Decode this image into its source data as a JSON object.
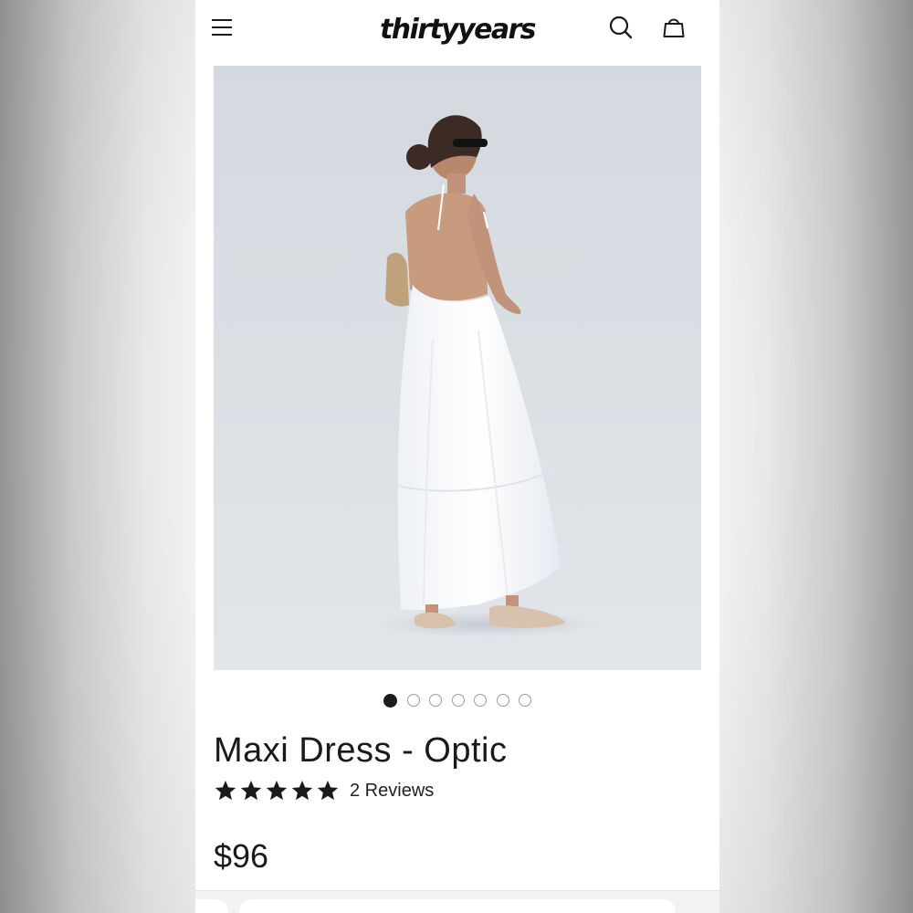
{
  "header": {
    "brand": "thirtyyears",
    "icons": {
      "menu": "menu-icon",
      "search": "search-icon",
      "cart": "cart-bag-icon"
    }
  },
  "gallery": {
    "image_subject": "model in white backless maxi dress",
    "slide_count": 7,
    "active_slide": 1
  },
  "product": {
    "title": "Maxi Dress - Optic",
    "rating": 5,
    "rating_max": 5,
    "reviews_label": "2 Reviews",
    "price": "$96"
  },
  "colors": {
    "text": "#1a1a1a",
    "hero_background": "#d8dee4",
    "active_dot": "#1c1c1c"
  }
}
